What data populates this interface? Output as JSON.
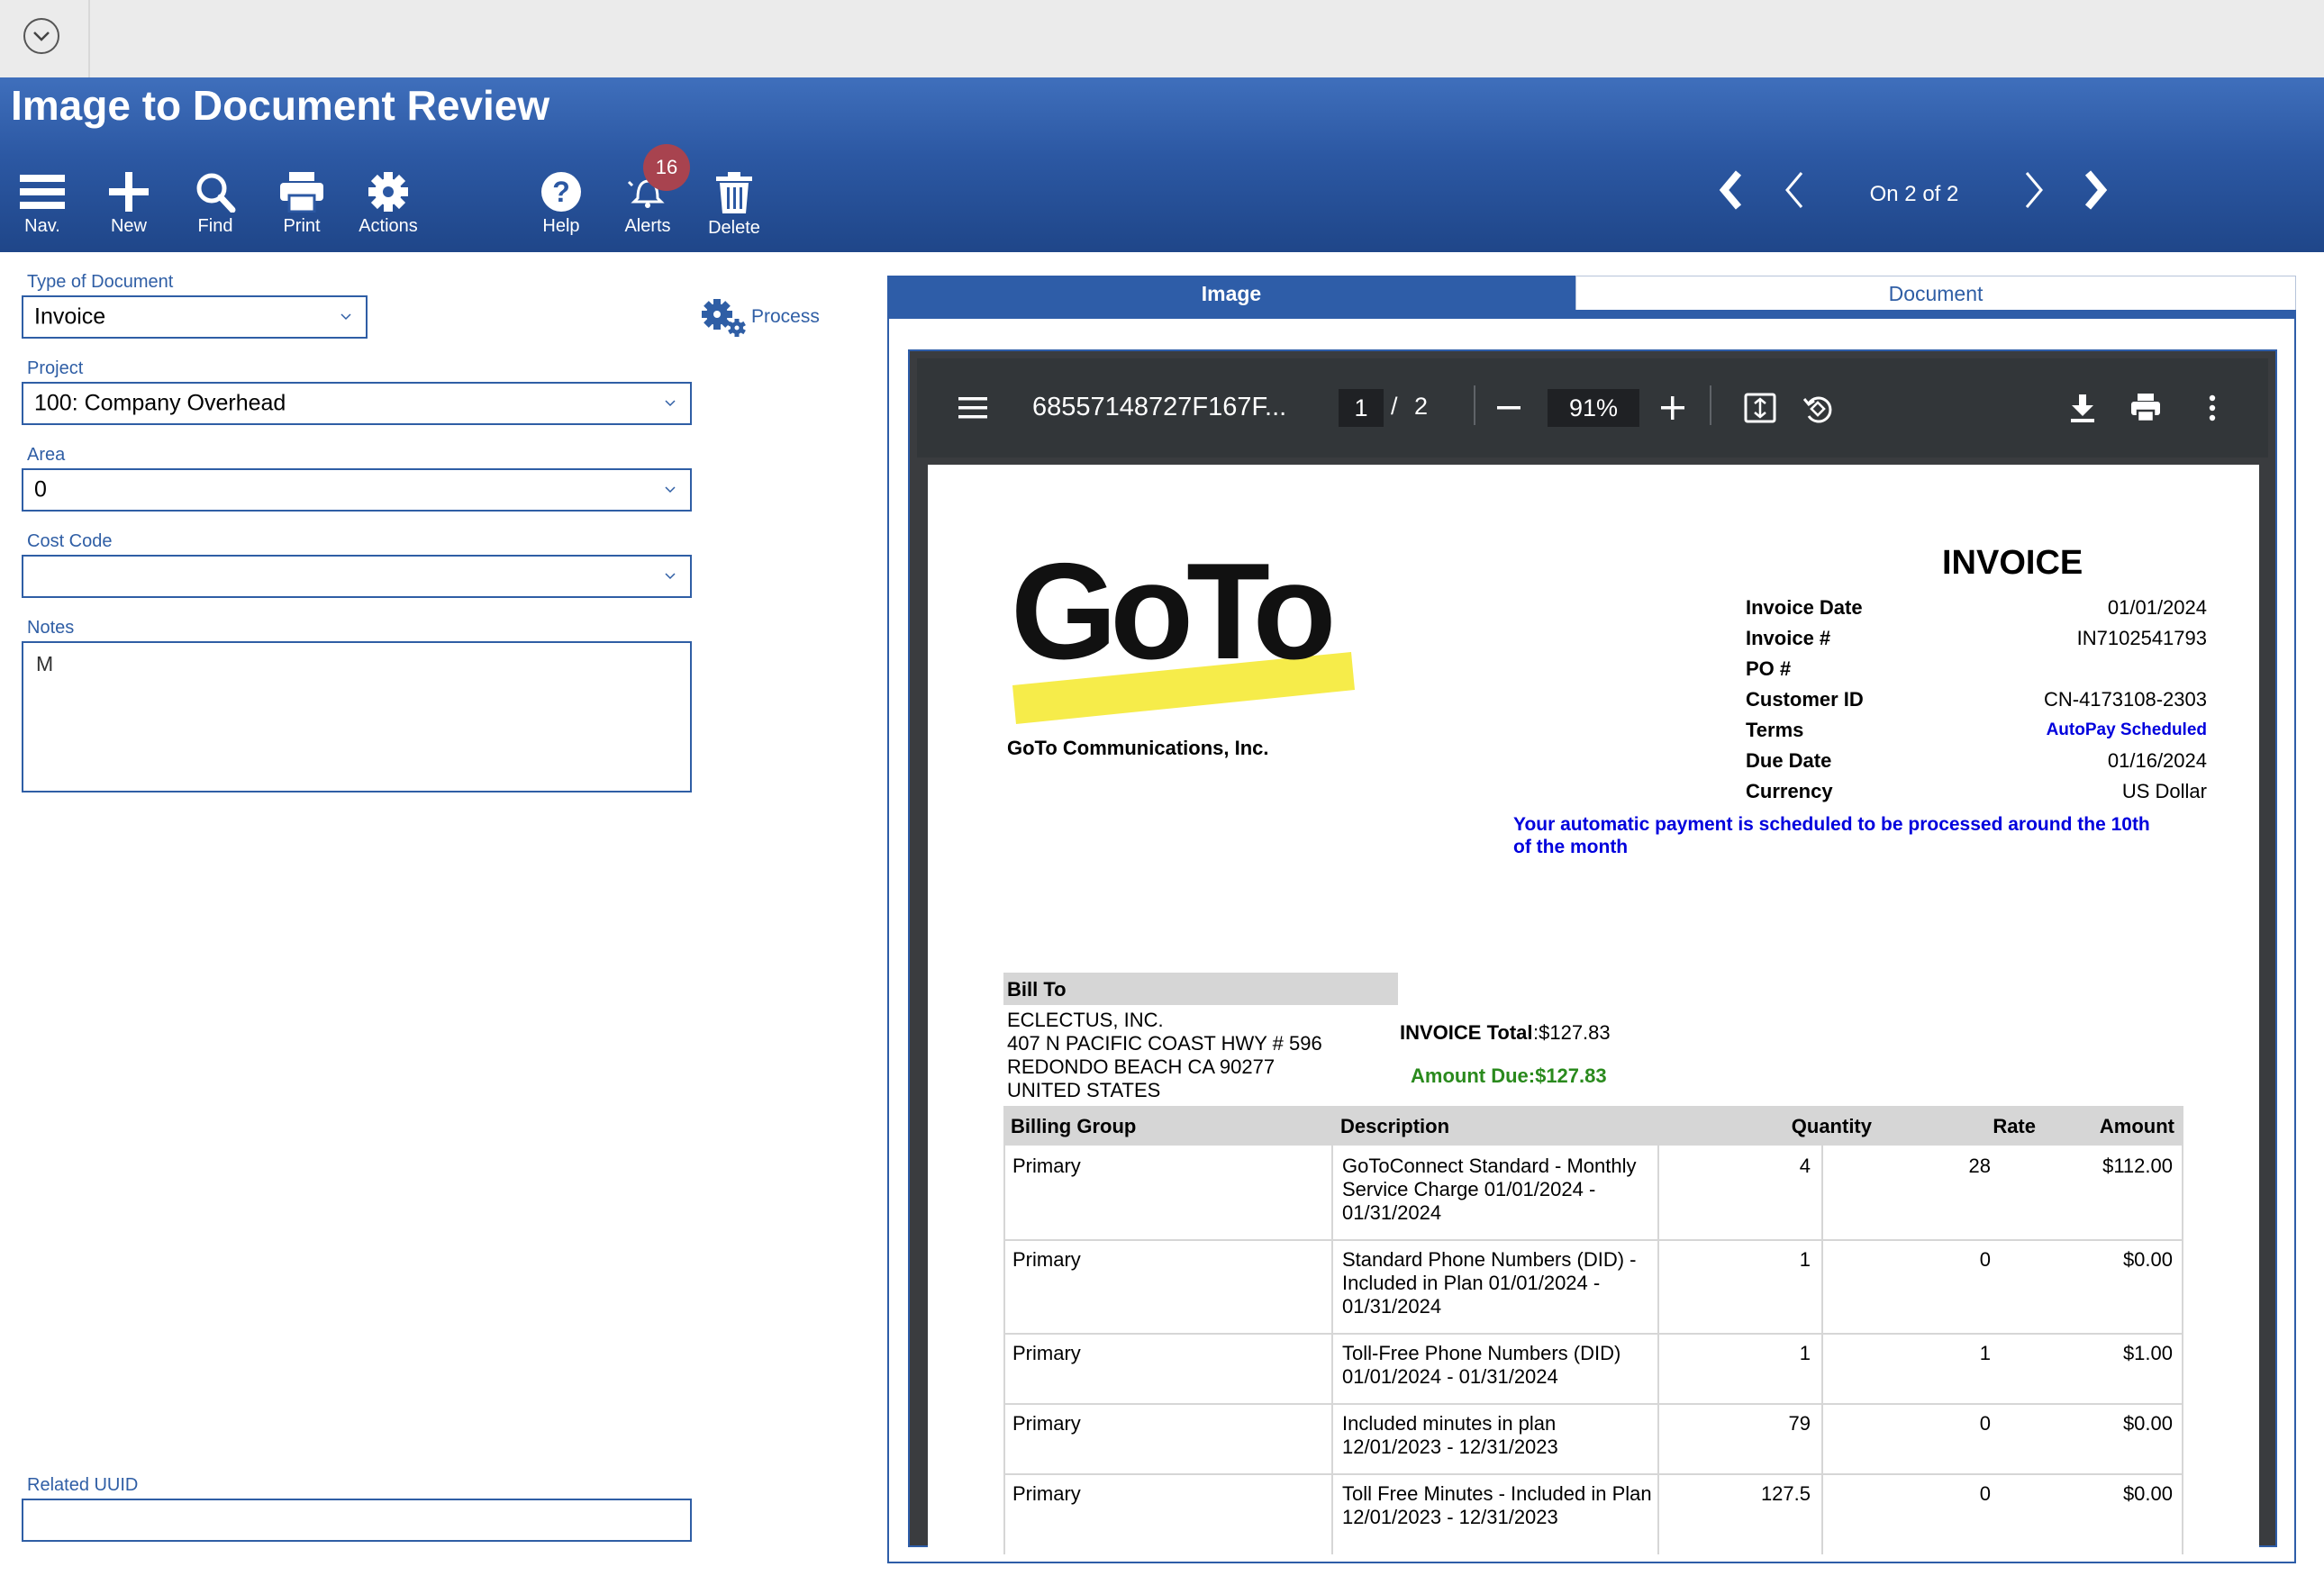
{
  "app": {
    "title": "Image to Document Review"
  },
  "toolbar": {
    "nav": "Nav.",
    "new": "New",
    "find": "Find",
    "print": "Print",
    "actions": "Actions",
    "help": "Help",
    "alerts": "Alerts",
    "alerts_count": "16",
    "delete": "Delete"
  },
  "pager": {
    "status": "On 2 of 2"
  },
  "form": {
    "type_label": "Type of Document",
    "type_value": "Invoice",
    "process_label": "Process",
    "project_label": "Project",
    "project_value": "100: Company Overhead",
    "area_label": "Area",
    "area_value": "0",
    "cost_code_label": "Cost Code",
    "cost_code_value": "",
    "notes_label": "Notes",
    "notes_value": "M",
    "related_uuid_label": "Related UUID",
    "related_uuid_value": ""
  },
  "tabs": {
    "image": "Image",
    "document": "Document"
  },
  "pdf_viewer": {
    "filename": "68557148727F167F...",
    "page_current": "1",
    "page_sep": "/",
    "page_total": "2",
    "zoom": "91%"
  },
  "invoice": {
    "vendor": "GoTo Communications, Inc.",
    "logo_text": "GoTo",
    "heading": "INVOICE",
    "meta": [
      {
        "label": "Invoice Date",
        "value": "01/01/2024"
      },
      {
        "label": "Invoice #",
        "value": "IN7102541793"
      },
      {
        "label": "PO #",
        "value": ""
      },
      {
        "label": "Customer ID",
        "value": "CN-4173108-2303"
      },
      {
        "label": "Terms",
        "value": "AutoPay Scheduled"
      },
      {
        "label": "Due Date",
        "value": "01/16/2024"
      },
      {
        "label": "Currency",
        "value": "US Dollar"
      }
    ],
    "autopay_note_1": "Your automatic payment is scheduled to be processed around the 10th",
    "autopay_note_2": "of the month",
    "bill_to_label": "Bill To",
    "bill_to_lines": [
      "ECLECTUS, INC.",
      "407 N PACIFIC COAST HWY # 596",
      "REDONDO BEACH CA 90277",
      "UNITED STATES"
    ],
    "total_label": "INVOICE Total",
    "total_value": ":$127.83",
    "amount_due": "Amount Due:$127.83",
    "columns": [
      "Billing Group",
      "Description",
      "Quantity",
      "Rate",
      "Amount"
    ],
    "rows": [
      {
        "group": "Primary",
        "desc": [
          "GoToConnect Standard - Monthly",
          "Service Charge 01/01/2024 -",
          "01/31/2024"
        ],
        "qty": "4",
        "rate": "28",
        "amount": "$112.00"
      },
      {
        "group": "Primary",
        "desc": [
          "Standard Phone Numbers (DID) -",
          "Included in Plan 01/01/2024 -",
          "01/31/2024"
        ],
        "qty": "1",
        "rate": "0",
        "amount": "$0.00"
      },
      {
        "group": "Primary",
        "desc": [
          "Toll-Free Phone Numbers (DID)",
          "01/01/2024 - 01/31/2024"
        ],
        "qty": "1",
        "rate": "1",
        "amount": "$1.00"
      },
      {
        "group": "Primary",
        "desc": [
          "Included minutes in plan",
          "12/01/2023 - 12/31/2023"
        ],
        "qty": "79",
        "rate": "0",
        "amount": "$0.00"
      },
      {
        "group": "Primary",
        "desc": [
          "Toll Free Minutes - Included in Plan",
          "12/01/2023 - 12/31/2023"
        ],
        "qty": "127.5",
        "rate": "0",
        "amount": "$0.00"
      }
    ]
  },
  "colors": {
    "header_blue": "#2c58a3",
    "link_blue": "#2f5ea5",
    "autopay_blue": "#0000dd",
    "amount_green": "#2a8a1d",
    "logo_yellow": "#f6ec4a"
  }
}
